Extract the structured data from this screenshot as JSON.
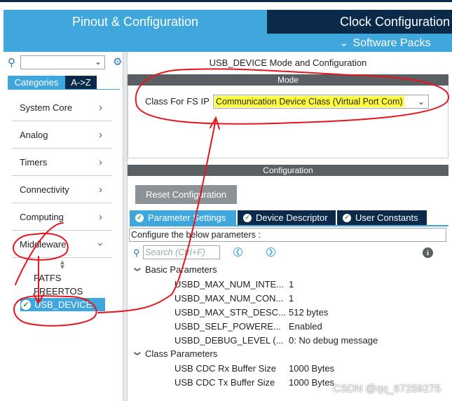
{
  "header": {
    "tab_pinout": "Pinout & Configuration",
    "tab_clock": "Clock Configuration",
    "software_packs": "Software Packs"
  },
  "left": {
    "tab_categories": "Categories",
    "tab_az": "A->Z",
    "categories": [
      {
        "label": "System Core"
      },
      {
        "label": "Analog"
      },
      {
        "label": "Timers"
      },
      {
        "label": "Connectivity"
      },
      {
        "label": "Computing"
      },
      {
        "label": "Middleware"
      }
    ],
    "middleware_items": [
      "FATFS",
      "FREERTOS",
      "USB_DEVICE"
    ]
  },
  "mode": {
    "title": "USB_DEVICE Mode and Configuration",
    "section": "Mode",
    "class_label": "Class For FS IP",
    "class_value": "Communication Device Class (Virtual Port Com)"
  },
  "config": {
    "section": "Configuration",
    "reset_label": "Reset Configuration",
    "tabs": [
      "Parameter Settings",
      "Device Descriptor",
      "User Constants"
    ],
    "configure_text": "Configure the below parameters :",
    "search_placeholder": "Search (Ctrl+F)",
    "groups": [
      {
        "name": "Basic Parameters",
        "params": [
          {
            "name": "USBD_MAX_NUM_INTE...",
            "value": "1"
          },
          {
            "name": "USBD_MAX_NUM_CON...",
            "value": "1"
          },
          {
            "name": "USBD_MAX_STR_DESC...",
            "value": "512 bytes"
          },
          {
            "name": "USBD_SELF_POWERE...",
            "value": "Enabled"
          },
          {
            "name": "USBD_DEBUG_LEVEL (...",
            "value": "0: No debug message"
          }
        ]
      },
      {
        "name": "Class Parameters",
        "params": [
          {
            "name": "USB CDC Rx Buffer Size",
            "value": "1000 Bytes"
          },
          {
            "name": "USB CDC Tx Buffer Size",
            "value": "1000 Bytes"
          }
        ]
      }
    ]
  },
  "watermark": "CSDN @qq_67259275",
  "colors": {
    "accent": "#3fa7dc",
    "dark": "#0b2a4a",
    "section_header": "#5a5f63",
    "highlight": "#ffff3a",
    "annotation": "#e8141e"
  }
}
